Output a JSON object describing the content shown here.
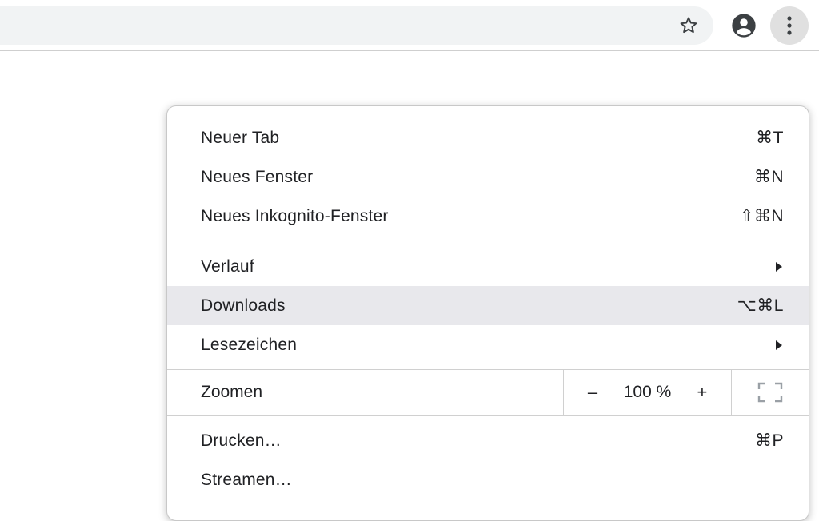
{
  "toolbar": {
    "star_icon": "bookmark-star-icon",
    "profile_icon": "account-circle-icon",
    "menu_icon": "three-dots-vertical-icon"
  },
  "menu": {
    "section1": [
      {
        "label": "Neuer Tab",
        "shortcut": "⌘T"
      },
      {
        "label": "Neues Fenster",
        "shortcut": "⌘N"
      },
      {
        "label": "Neues Inkognito-Fenster",
        "shortcut": "⇧⌘N"
      }
    ],
    "section2": [
      {
        "label": "Verlauf",
        "submenu": true
      },
      {
        "label": "Downloads",
        "shortcut": "⌥⌘L",
        "highlighted": true
      },
      {
        "label": "Lesezeichen",
        "submenu": true
      }
    ],
    "zoom": {
      "label": "Zoomen",
      "minus": "–",
      "value": "100 %",
      "plus": "+",
      "fullscreen_icon": "fullscreen-icon"
    },
    "section4": [
      {
        "label": "Drucken…",
        "shortcut": "⌘P"
      },
      {
        "label": "Streamen…"
      }
    ]
  },
  "colors": {
    "omnibox_bg": "#f1f3f4",
    "highlight_bg": "#e8e8ec",
    "menu_button_bg": "#e0e0e0",
    "text": "#202124"
  }
}
